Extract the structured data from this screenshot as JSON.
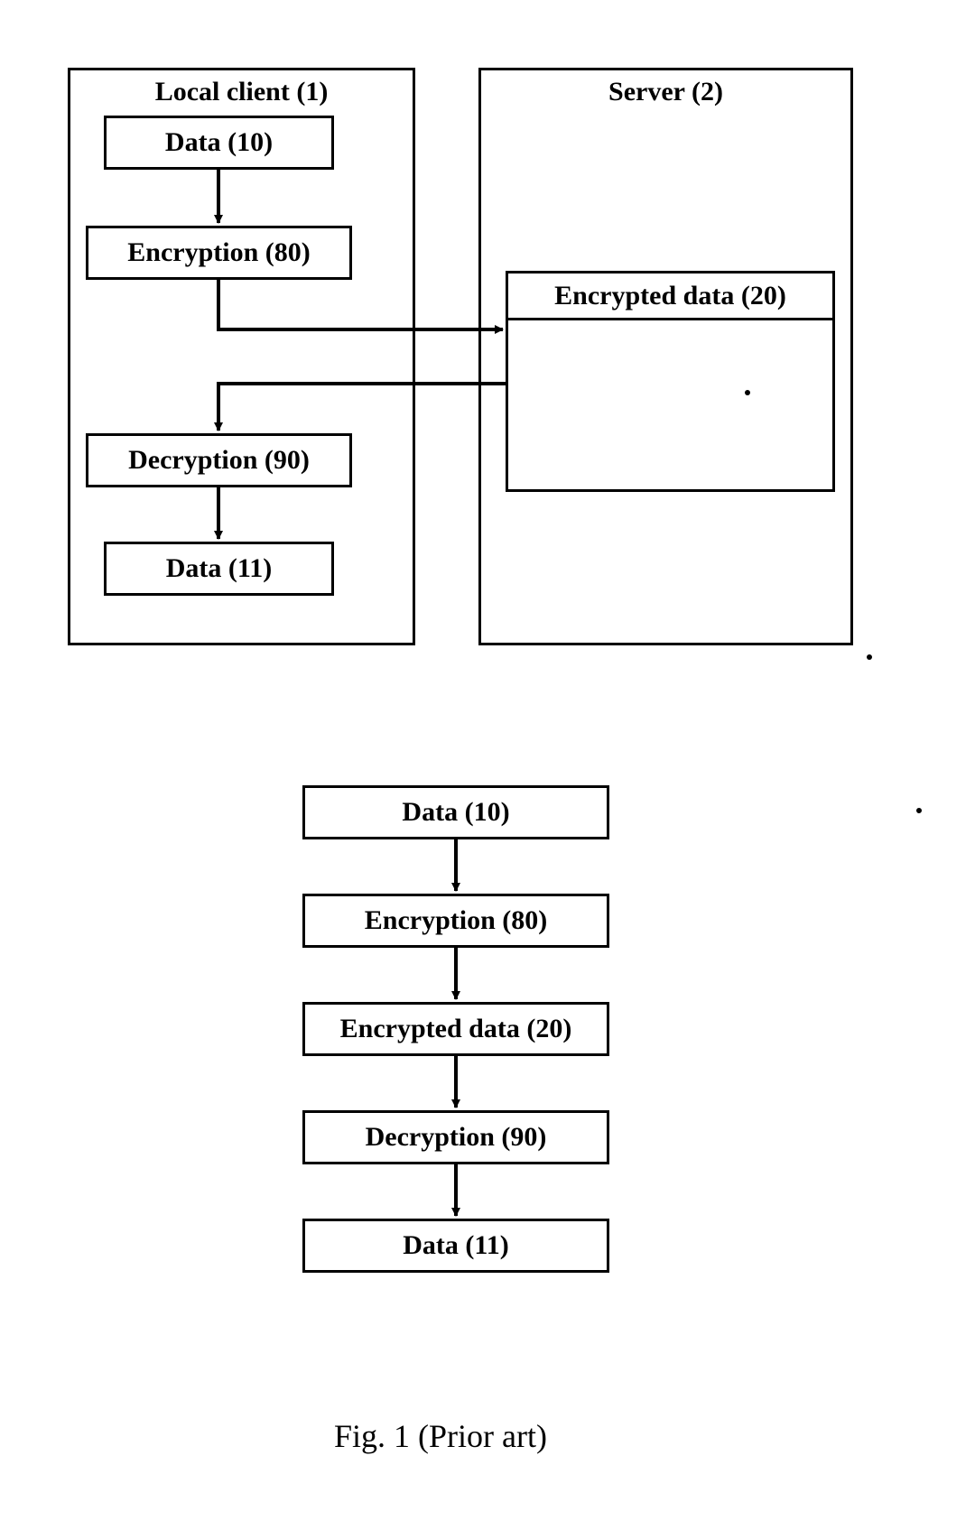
{
  "top": {
    "client": {
      "title": "Local client (1)",
      "data10": "Data (10)",
      "encryption": "Encryption (80)",
      "decryption": "Decryption (90)",
      "data11": "Data (11)"
    },
    "server": {
      "title": "Server (2)",
      "encrypted": "Encrypted data (20)"
    }
  },
  "bottom": {
    "data10": "Data (10)",
    "encryption": "Encryption (80)",
    "encrypted": "Encrypted data (20)",
    "decryption": "Decryption (90)",
    "data11": "Data (11)"
  },
  "caption": "Fig. 1  (Prior art)"
}
